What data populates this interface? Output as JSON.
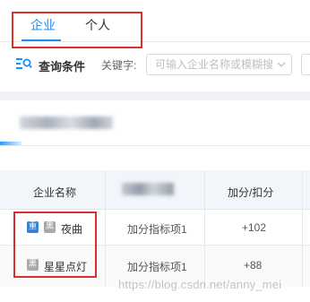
{
  "tabs": [
    {
      "label": "企业",
      "active": true
    },
    {
      "label": "个人",
      "active": false
    }
  ],
  "query": {
    "title": "查询条件",
    "keyword_label": "关键字:",
    "keyword_placeholder": "可输入企业名称或模糊搜",
    "keyword_value": ""
  },
  "table": {
    "headers": [
      "企业名称",
      "加分/扣分"
    ],
    "rows": [
      {
        "tags": [
          "重",
          "黑"
        ],
        "name": "夜曲",
        "item": "加分指标项1",
        "score": "+102"
      },
      {
        "tags": [
          "黑"
        ],
        "name": "星星点灯",
        "item": "加分指标项1",
        "score": "+88"
      }
    ]
  },
  "watermark": "https://blog.csdn.net/anny_mei",
  "colors": {
    "accent": "#1890ff",
    "highlight_box": "#d7312f",
    "tag_blue": "#3a7fd5",
    "tag_gray": "#a9a9a9"
  }
}
